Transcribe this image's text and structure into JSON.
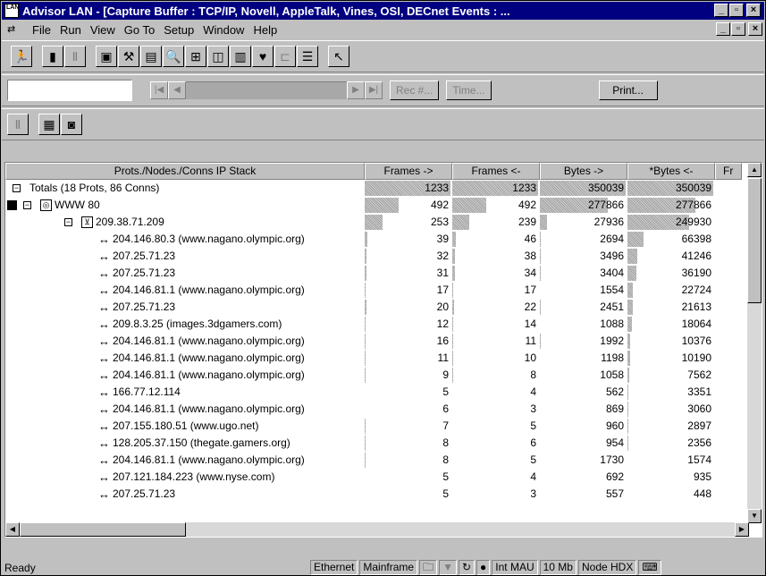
{
  "window": {
    "title": "Advisor LAN - [Capture Buffer : TCP/IP, Novell, AppleTalk, Vines, OSI, DECnet Events : ...",
    "app_icon_text": "LAN"
  },
  "menu": {
    "items": [
      {
        "label": "File"
      },
      {
        "label": "Run"
      },
      {
        "label": "View"
      },
      {
        "label": "Go To"
      },
      {
        "label": "Setup"
      },
      {
        "label": "Window"
      },
      {
        "label": "Help"
      }
    ]
  },
  "nav": {
    "rec_label": "Rec #...",
    "time_label": "Time...",
    "print_label": "Print..."
  },
  "grid": {
    "headers": [
      "Prots./Nodes./Conns IP Stack",
      "Frames ->",
      "Frames <-",
      "Bytes ->",
      "*Bytes <-",
      "Fr"
    ],
    "max": {
      "fo": 1233,
      "fi": 1233,
      "bo": 350039,
      "bi": 350039
    },
    "rows": [
      {
        "name": "Totals (18 Prots, 86 Conns)",
        "level": 0,
        "kind": "totals",
        "fo": 1233,
        "fi": 1233,
        "bo": 350039,
        "bi": 350039
      },
      {
        "name": "WWW 80",
        "level": 1,
        "kind": "proto",
        "fo": 492,
        "fi": 492,
        "bo": 277866,
        "bi": 277866
      },
      {
        "name": "209.38.71.209",
        "level": 2,
        "kind": "node",
        "fo": 253,
        "fi": 239,
        "bo": 27936,
        "bi": 249930
      },
      {
        "name": "204.146.80.3 (www.nagano.olympic.org)",
        "level": 3,
        "kind": "conn",
        "fo": 39,
        "fi": 46,
        "bo": 2694,
        "bi": 66398
      },
      {
        "name": "207.25.71.23",
        "level": 3,
        "kind": "conn",
        "fo": 32,
        "fi": 38,
        "bo": 3496,
        "bi": 41246
      },
      {
        "name": "207.25.71.23",
        "level": 3,
        "kind": "conn",
        "fo": 31,
        "fi": 34,
        "bo": 3404,
        "bi": 36190
      },
      {
        "name": "204.146.81.1 (www.nagano.olympic.org)",
        "level": 3,
        "kind": "conn",
        "fo": 17,
        "fi": 17,
        "bo": 1554,
        "bi": 22724
      },
      {
        "name": "207.25.71.23",
        "level": 3,
        "kind": "conn",
        "fo": 20,
        "fi": 22,
        "bo": 2451,
        "bi": 21613
      },
      {
        "name": "209.8.3.25 (images.3dgamers.com)",
        "level": 3,
        "kind": "conn",
        "fo": 12,
        "fi": 14,
        "bo": 1088,
        "bi": 18064
      },
      {
        "name": "204.146.81.1 (www.nagano.olympic.org)",
        "level": 3,
        "kind": "conn",
        "fo": 16,
        "fi": 11,
        "bo": 1992,
        "bi": 10376
      },
      {
        "name": "204.146.81.1 (www.nagano.olympic.org)",
        "level": 3,
        "kind": "conn",
        "fo": 11,
        "fi": 10,
        "bo": 1198,
        "bi": 10190
      },
      {
        "name": "204.146.81.1 (www.nagano.olympic.org)",
        "level": 3,
        "kind": "conn",
        "fo": 9,
        "fi": 8,
        "bo": 1058,
        "bi": 7562
      },
      {
        "name": "166.77.12.114",
        "level": 3,
        "kind": "conn",
        "fo": 5,
        "fi": 4,
        "bo": 562,
        "bi": 3351
      },
      {
        "name": "204.146.81.1 (www.nagano.olympic.org)",
        "level": 3,
        "kind": "conn",
        "fo": 6,
        "fi": 3,
        "bo": 869,
        "bi": 3060
      },
      {
        "name": "207.155.180.51 (www.ugo.net)",
        "level": 3,
        "kind": "conn",
        "fo": 7,
        "fi": 5,
        "bo": 960,
        "bi": 2897
      },
      {
        "name": "128.205.37.150 (thegate.gamers.org)",
        "level": 3,
        "kind": "conn",
        "fo": 8,
        "fi": 6,
        "bo": 954,
        "bi": 2356
      },
      {
        "name": "204.146.81.1 (www.nagano.olympic.org)",
        "level": 3,
        "kind": "conn",
        "fo": 8,
        "fi": 5,
        "bo": 1730,
        "bi": 1574
      },
      {
        "name": "207.121.184.223 (www.nyse.com)",
        "level": 3,
        "kind": "conn",
        "fo": 5,
        "fi": 4,
        "bo": 692,
        "bi": 935
      },
      {
        "name": "207.25.71.23",
        "level": 3,
        "kind": "conn",
        "fo": 5,
        "fi": 3,
        "bo": 557,
        "bi": 448
      }
    ]
  },
  "status": {
    "text": "Ready",
    "panels": [
      "Ethernet",
      "Mainframe",
      "Int MAU",
      "10 Mb",
      "Node HDX"
    ]
  }
}
